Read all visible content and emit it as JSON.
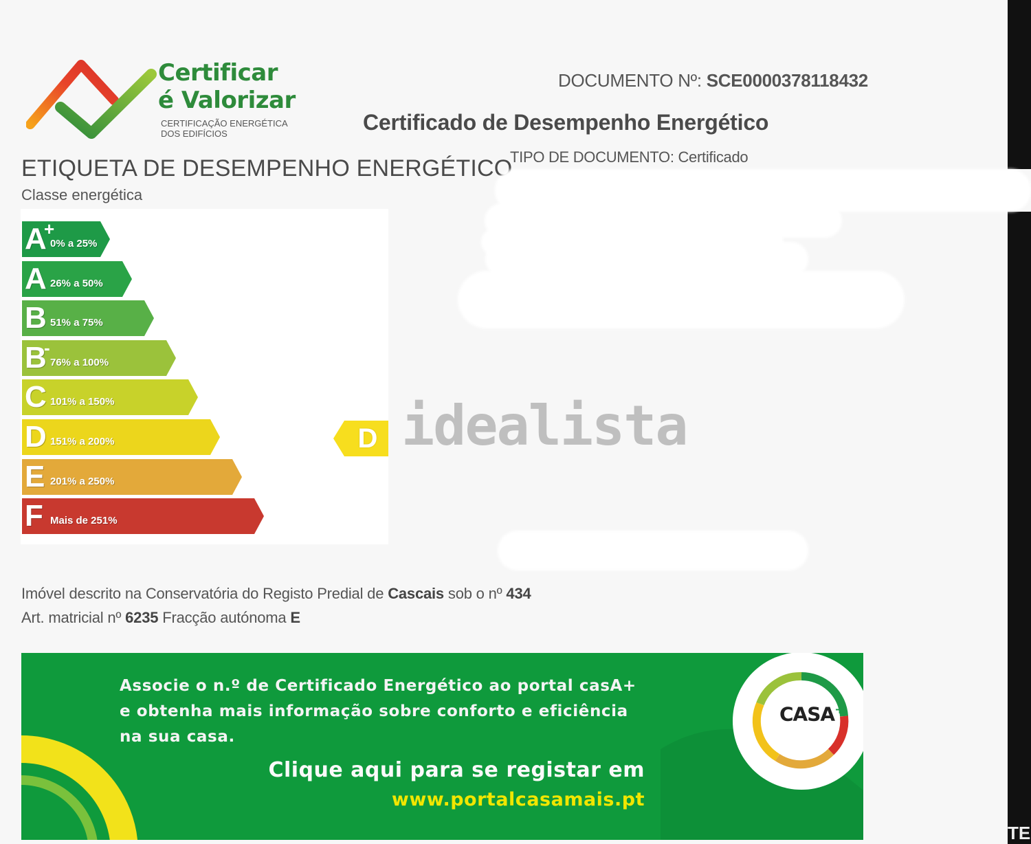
{
  "header": {
    "logo": {
      "title_line1": "Certificar",
      "title_line2": "é Valorizar",
      "subtitle_line1": "CERTIFICAÇÃO ENERGÉTICA",
      "subtitle_line2": "DOS EDIFÍCIOS"
    },
    "document_number_label": "DOCUMENTO Nº:",
    "document_number": "SCE0000378118432",
    "document_title": "Certificado de Desempenho Energético",
    "document_type_label": "TIPO DE DOCUMENTO:",
    "document_type": "Certificado"
  },
  "label": {
    "heading": "ETIQUETA DE DESEMPENHO ENERGÉTICO",
    "subheading": "Classe energética",
    "classes": [
      {
        "letter": "A",
        "modifier": "+",
        "range": "0% a 25%",
        "color": "#1e9a47"
      },
      {
        "letter": "A",
        "modifier": "",
        "range": "26% a 50%",
        "color": "#2aa347"
      },
      {
        "letter": "B",
        "modifier": "",
        "range": "51% a 75%",
        "color": "#58b047"
      },
      {
        "letter": "B",
        "modifier": "-",
        "range": "76% a 100%",
        "color": "#9bc23b"
      },
      {
        "letter": "C",
        "modifier": "",
        "range": "101% a 150%",
        "color": "#c8d22a"
      },
      {
        "letter": "D",
        "modifier": "",
        "range": "151% a 200%",
        "color": "#ecd61c"
      },
      {
        "letter": "E",
        "modifier": "",
        "range": "201% a 250%",
        "color": "#e3a93a"
      },
      {
        "letter": "F",
        "modifier": "",
        "range": "Mais de 251%",
        "color": "#c8392f"
      }
    ],
    "current_class": "D",
    "current_class_color": "#f7de1e"
  },
  "watermark": "idealista",
  "property": {
    "line1_prefix": "Imóvel descrito na Conservatória do Registo Predial de",
    "registry": "Cascais",
    "line1_mid": "sob o nº",
    "registry_number": "434",
    "line2_prefix": "Art. matricial nº",
    "matrix_article": "6235",
    "line2_mid": "Fracção autónoma",
    "fraction": "E"
  },
  "banner": {
    "text_line1": "Associe o n.º de Certificado Energético ao portal casA+",
    "text_line2": "e obtenha mais informação sobre conforto e eficiência",
    "text_line3": "na sua casa.",
    "cta": "Clique aqui para se registar em",
    "url": "www.portalcasamais.pt",
    "logo_text": "CASA",
    "logo_sup": "+",
    "bg_color": "#0f9a3c",
    "url_color": "#f1e600"
  },
  "edge_text": "TE"
}
